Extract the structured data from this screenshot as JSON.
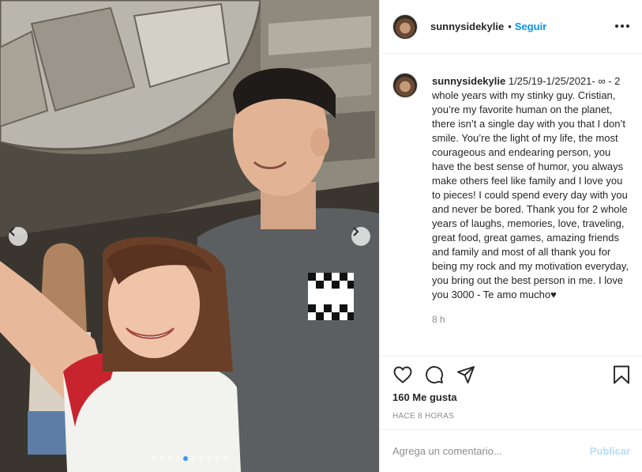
{
  "post": {
    "username": "sunnysidekylie",
    "follow_label": "Seguir",
    "separator": "•",
    "caption_text": "1/25/19-1/25/2021- ∞ - 2 whole years with my stinky guy. Cristian, you’re my favorite human on the planet, there isn’t a single day with you that I don’t smile. You’re the light of my life, the most courageous and endearing person, you have the best sense of humor, you always make others feel like family and I love you to pieces! I could spend every day with you and never be bored. Thank you for 2 whole years of laughs, memories, love, traveling, great food, great games, amazing friends and family and most of all thank you for being my rock and my motivation everyday, you bring out the best person in me. I love you 3000 - Te amo mucho♥",
    "caption_time": "8 h",
    "likes": "160 Me gusta",
    "timestamp": "HACE 8 HORAS"
  },
  "comment": {
    "placeholder": "Agrega un comentario...",
    "post_label": "Publicar"
  },
  "carousel": {
    "slide_count": 10,
    "active_index": 4
  },
  "icons": {
    "more": "more-options-icon",
    "like": "heart-icon",
    "comment": "comment-icon",
    "share": "share-icon",
    "save": "bookmark-icon",
    "prev": "chevron-left-icon",
    "next": "chevron-right-icon"
  },
  "colors": {
    "accent": "#0095f6",
    "muted": "#8e8e8e",
    "disabled_accent": "#b2dffc",
    "carousel_active_dot": "#3897f0"
  }
}
